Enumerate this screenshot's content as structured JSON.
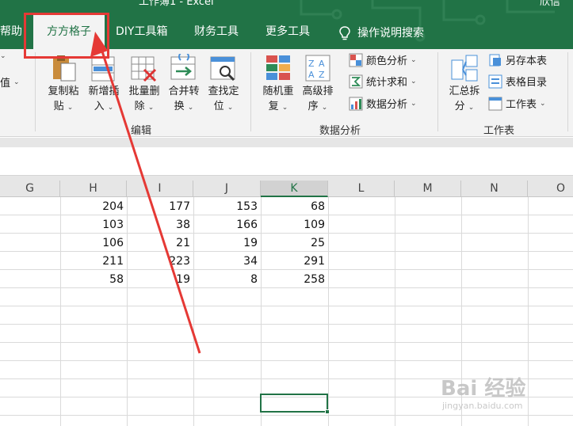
{
  "window": {
    "title": "工作簿1  -  Excel",
    "user": "欣信",
    "accent": "#217346"
  },
  "tabs": {
    "help": "帮助",
    "ffgz": "方方格子",
    "diy": "DIY工具箱",
    "finance": "财务工具",
    "more": "更多工具",
    "search": "操作说明搜索"
  },
  "ribbon": {
    "left_cut": {
      "label": "值"
    },
    "edit_group": {
      "copy_paste": {
        "line1": "复制粘",
        "line2": "贴"
      },
      "insert": {
        "line1": "新增插",
        "line2": "入"
      },
      "batch_delete": {
        "line1": "批量删",
        "line2": "除"
      },
      "merge_convert": {
        "line1": "合并转",
        "line2": "换"
      },
      "find_locate": {
        "line1": "查找定",
        "line2": "位"
      },
      "label": "编辑"
    },
    "analysis_group": {
      "random_repeat": {
        "line1": "随机重",
        "line2": "复"
      },
      "advanced_sort": {
        "line1": "高级排",
        "line2": "序"
      },
      "color_analysis": "颜色分析",
      "stat_sum": "统计求和",
      "data_analysis": "数据分析",
      "label": "数据分析"
    },
    "sheet_group": {
      "summary_split": {
        "line1": "汇总拆",
        "line2": "分"
      },
      "save_sheet": "另存本表",
      "sheet_index": "表格目录",
      "worksheet": "工作表",
      "label": "工作表"
    }
  },
  "grid": {
    "columns": [
      "G",
      "H",
      "I",
      "J",
      "K",
      "L",
      "M",
      "N",
      "O"
    ],
    "selected_column": "K",
    "rows": [
      [
        "204",
        "177",
        "153",
        "68"
      ],
      [
        "103",
        "38",
        "166",
        "109"
      ],
      [
        "106",
        "21",
        "19",
        "25"
      ],
      [
        "211",
        "223",
        "34",
        "291"
      ],
      [
        "58",
        "19",
        "8",
        "258"
      ]
    ]
  },
  "watermark": {
    "text": "Bai 经验",
    "url": "jingyan.baidu.com"
  }
}
